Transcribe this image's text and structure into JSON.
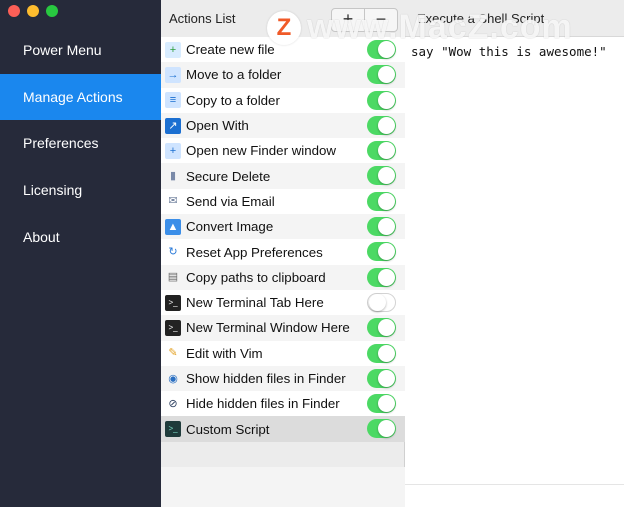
{
  "sidebar": {
    "items": [
      {
        "label": "Power Menu",
        "active": false
      },
      {
        "label": "Manage Actions",
        "active": true
      },
      {
        "label": "Preferences",
        "active": false
      },
      {
        "label": "Licensing",
        "active": false
      },
      {
        "label": "About",
        "active": false
      }
    ]
  },
  "actions_list": {
    "title": "Actions List",
    "add_label": "+",
    "remove_label": "−",
    "items": [
      {
        "label": "Create new file",
        "icon": "new-file-icon",
        "enabled": true
      },
      {
        "label": "Move to a folder",
        "icon": "move-folder-icon",
        "enabled": true
      },
      {
        "label": "Copy to a folder",
        "icon": "copy-folder-icon",
        "enabled": true
      },
      {
        "label": "Open With",
        "icon": "open-with-icon",
        "enabled": true
      },
      {
        "label": "Open new Finder window",
        "icon": "finder-window-icon",
        "enabled": true
      },
      {
        "label": "Secure Delete",
        "icon": "trash-icon",
        "enabled": true
      },
      {
        "label": "Send via Email",
        "icon": "email-icon",
        "enabled": true
      },
      {
        "label": "Convert Image",
        "icon": "image-icon",
        "enabled": true
      },
      {
        "label": "Reset App Preferences",
        "icon": "reset-icon",
        "enabled": true
      },
      {
        "label": "Copy paths to clipboard",
        "icon": "clipboard-icon",
        "enabled": true
      },
      {
        "label": "New Terminal Tab Here",
        "icon": "terminal-icon",
        "enabled": false
      },
      {
        "label": "New Terminal Window Here",
        "icon": "terminal-icon",
        "enabled": true
      },
      {
        "label": "Edit with Vim",
        "icon": "pencil-icon",
        "enabled": true
      },
      {
        "label": "Show hidden files in Finder",
        "icon": "eye-icon",
        "enabled": true
      },
      {
        "label": "Hide hidden files in Finder",
        "icon": "eye-slash-icon",
        "enabled": true
      },
      {
        "label": "Custom Script",
        "icon": "script-terminal-icon",
        "enabled": true,
        "selected": true
      }
    ]
  },
  "editor": {
    "title": "Execute a Shell Script",
    "code": "say \"Wow this is awesome!\""
  },
  "watermark": {
    "logo_letter": "Z",
    "text": "www.MacZ.com"
  },
  "colors": {
    "sidebar_bg": "#262a3a",
    "accent": "#1a87ee",
    "toggle_on": "#4cd964"
  }
}
